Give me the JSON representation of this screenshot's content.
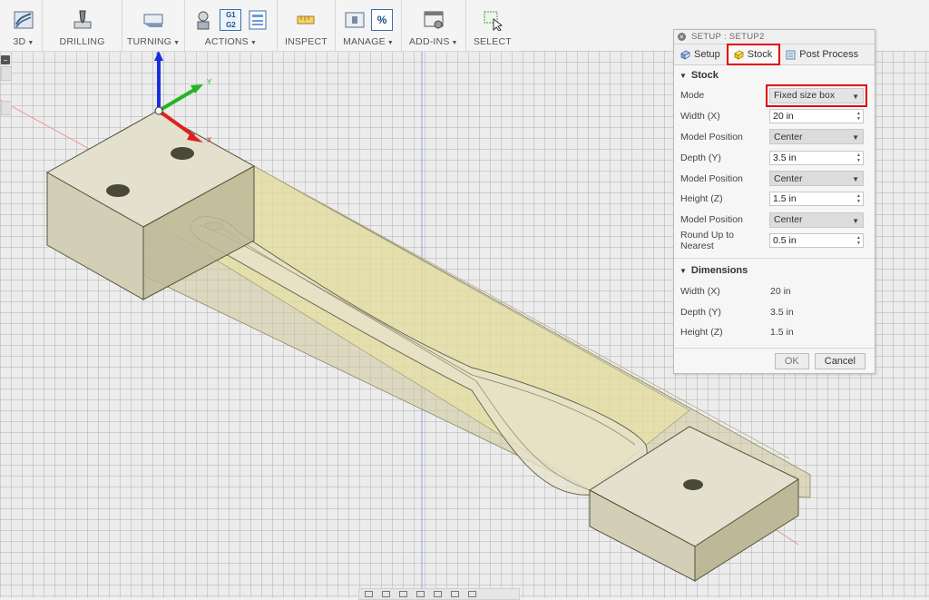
{
  "toolbar": {
    "groups": [
      {
        "label": "3D",
        "dropdown": true
      },
      {
        "label": "DRILLING",
        "dropdown": false
      },
      {
        "label": "TURNING",
        "dropdown": true
      },
      {
        "label": "ACTIONS",
        "dropdown": true
      },
      {
        "label": "INSPECT",
        "dropdown": false
      },
      {
        "label": "MANAGE",
        "dropdown": true
      },
      {
        "label": "ADD-INS",
        "dropdown": true
      },
      {
        "label": "SELECT",
        "dropdown": false
      }
    ],
    "actions_icon_text": {
      "top": "G1",
      "bottom": "G2"
    },
    "manage_icon_text": "%"
  },
  "axes": {
    "x": "X",
    "y": "Y",
    "z": "Z"
  },
  "dialog": {
    "title": "SETUP : SETUP2",
    "tabs": [
      {
        "label": "Setup"
      },
      {
        "label": "Stock",
        "active": true
      },
      {
        "label": "Post Process"
      }
    ],
    "stock_section": "Stock",
    "mode_label": "Mode",
    "mode_value": "Fixed size box",
    "width_label": "Width (X)",
    "width_value": "20 in",
    "model_position_label": "Model Position",
    "model_position_x": "Center",
    "depth_label": "Depth (Y)",
    "depth_value": "3.5 in",
    "model_position_y": "Center",
    "height_label": "Height (Z)",
    "height_value": "1.5 in",
    "model_position_z": "Center",
    "round_label": "Round Up to Nearest",
    "round_value": "0.5 in",
    "dimensions_section": "Dimensions",
    "dim_width_label": "Width (X)",
    "dim_width_value": "20 in",
    "dim_depth_label": "Depth (Y)",
    "dim_depth_value": "3.5 in",
    "dim_height_label": "Height (Z)",
    "dim_height_value": "1.5 in",
    "ok_label": "OK",
    "cancel_label": "Cancel"
  },
  "colors": {
    "stock_translucent": "#cfc89a",
    "block_face_top": "#e3e1cd",
    "block_face_front": "#d2cfb6",
    "block_face_side": "#bdb998",
    "highlight": "#e00000",
    "axis_x": "#e02020",
    "axis_y": "#22b522",
    "axis_z": "#1a2ee0"
  }
}
